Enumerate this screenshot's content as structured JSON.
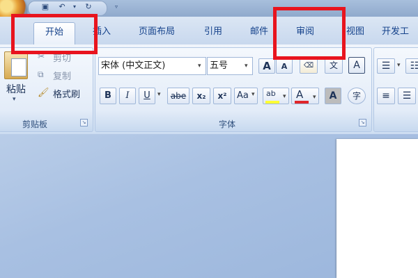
{
  "tabs": [
    "开始",
    "插入",
    "页面布局",
    "引用",
    "邮件",
    "审阅",
    "视图",
    "开发工"
  ],
  "clipboard": {
    "paste_label": "粘贴",
    "cut_label": "剪切",
    "copy_label": "复制",
    "format_painter_label": "格式刷",
    "group_label": "剪贴板"
  },
  "font": {
    "font_name": "宋体 (中文正文)",
    "font_size": "五号",
    "grow_label": "A",
    "shrink_label": "A",
    "bold": "B",
    "italic": "I",
    "underline": "U",
    "strikethrough": "abe",
    "subscript": "x₂",
    "superscript": "x²",
    "change_case": "Aa",
    "highlight": "ab",
    "font_color": "A",
    "char_shading": "A",
    "enclose": "字",
    "phonetic": "文",
    "border": "A",
    "group_label": "字体"
  },
  "colors": {
    "accent": "#15428b",
    "annotation": "#e8141e",
    "font_color_underline": "#e0262a",
    "highlight_yellow": "#ffff33"
  }
}
